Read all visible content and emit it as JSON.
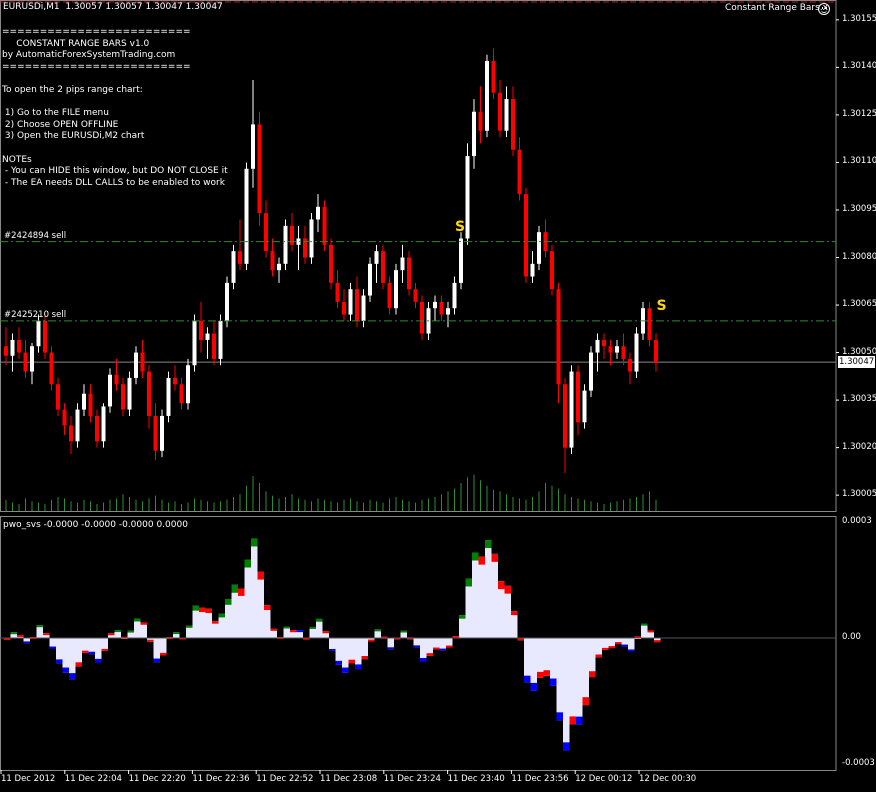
{
  "window": {
    "symbol_title": "EURUSDi,M1  1.30057 1.30057 1.30047 1.30047",
    "ea_title": "Constant Range Bars.x",
    "ea_status_icon": "smiley-icon"
  },
  "info_panel": {
    "lines": [
      "=========================",
      "     CONSTANT RANGE BARS v1.0",
      "by AutomaticForexSystemTrading.com",
      "=========================",
      "",
      "To open the 2 pips range chart:",
      "",
      " 1) Go to the FILE menu",
      " 2) Choose OPEN OFFLINE",
      " 3) Open the EURUSDi,M2 chart",
      "",
      "NOTEs",
      " - You can HIDE this window, but DO NOT CLOSE it",
      " - The EA needs DLL CALLS to be enabled to work"
    ]
  },
  "orders": [
    {
      "label": "#2424894 sell",
      "price": 1.30085
    },
    {
      "label": "#2425210 sell",
      "price": 1.3006
    }
  ],
  "signals": [
    {
      "text": "S",
      "bar_index": 70,
      "price": 1.30089
    },
    {
      "text": "S",
      "bar_index": 101,
      "price": 1.30064
    }
  ],
  "indicator": {
    "title": "pwo_svs -0.0000 -0.0000 -0.0000 0.0000",
    "scale_labels": [
      "0.0003",
      "0.00",
      "-0.0003"
    ]
  },
  "price_axis": {
    "labels": [
      "1.30155",
      "1.30140",
      "1.30125",
      "1.30110",
      "1.30095",
      "1.30080",
      "1.30065",
      "1.30050",
      "1.30035",
      "1.30020",
      "1.30005"
    ],
    "current_price": "1.30047",
    "current_value": 1.30047
  },
  "time_axis": {
    "labels": [
      "11 Dec 2012",
      "11 Dec 22:04",
      "11 Dec 22:20",
      "11 Dec 22:36",
      "11 Dec 22:52",
      "11 Dec 23:08",
      "11 Dec 23:24",
      "11 Dec 23:40",
      "11 Dec 23:56",
      "12 Dec 00:12",
      "12 Dec 00:30"
    ]
  },
  "colors": {
    "background": "#000000",
    "bull": "#ffffff",
    "bear": "#ff0000",
    "order_line": "#2e8b2e",
    "volume": "#2e8b2e",
    "signal": "#ffd700",
    "ind_fill": "#e8e8ff",
    "ind_blue": "#0000ff",
    "ind_green": "#008000",
    "ind_red": "#ff0000",
    "top_line": "#aa2222"
  },
  "chart_data": {
    "type": "candlestick",
    "ylim": [
      1.3,
      1.3016
    ],
    "bars": [
      [
        1.30052,
        1.30058,
        1.30046,
        1.30049
      ],
      [
        1.30049,
        1.30056,
        1.30044,
        1.30054
      ],
      [
        1.30054,
        1.30058,
        1.30048,
        1.3005
      ],
      [
        1.3005,
        1.30054,
        1.30042,
        1.30044
      ],
      [
        1.30044,
        1.30053,
        1.3004,
        1.30052
      ],
      [
        1.30052,
        1.30062,
        1.3005,
        1.3006
      ],
      [
        1.3006,
        1.30062,
        1.30048,
        1.3005
      ],
      [
        1.3005,
        1.30052,
        1.30038,
        1.3004
      ],
      [
        1.3004,
        1.30042,
        1.3003,
        1.30032
      ],
      [
        1.30032,
        1.30034,
        1.30024,
        1.30027
      ],
      [
        1.30027,
        1.3003,
        1.30018,
        1.30022
      ],
      [
        1.30022,
        1.30034,
        1.3002,
        1.30032
      ],
      [
        1.30032,
        1.3004,
        1.3003,
        1.30037
      ],
      [
        1.30037,
        1.3004,
        1.30028,
        1.3003
      ],
      [
        1.3003,
        1.30032,
        1.3002,
        1.30022
      ],
      [
        1.30022,
        1.30034,
        1.3002,
        1.30033
      ],
      [
        1.30033,
        1.30045,
        1.30031,
        1.30043
      ],
      [
        1.30043,
        1.30048,
        1.30038,
        1.3004
      ],
      [
        1.3004,
        1.30042,
        1.3003,
        1.30032
      ],
      [
        1.30032,
        1.30044,
        1.3003,
        1.30042
      ],
      [
        1.30042,
        1.30052,
        1.3004,
        1.3005
      ],
      [
        1.3005,
        1.30054,
        1.30042,
        1.30044
      ],
      [
        1.30044,
        1.30046,
        1.30026,
        1.3003
      ],
      [
        1.3003,
        1.30034,
        1.30016,
        1.30019
      ],
      [
        1.30019,
        1.30032,
        1.30017,
        1.3003
      ],
      [
        1.3003,
        1.30044,
        1.30028,
        1.30042
      ],
      [
        1.30042,
        1.30046,
        1.30038,
        1.3004
      ],
      [
        1.3004,
        1.30042,
        1.30032,
        1.30034
      ],
      [
        1.30034,
        1.30048,
        1.30032,
        1.30046
      ],
      [
        1.30046,
        1.30062,
        1.30044,
        1.3006
      ],
      [
        1.3006,
        1.30066,
        1.3005,
        1.30054
      ],
      [
        1.30054,
        1.30058,
        1.30048,
        1.30056
      ],
      [
        1.30056,
        1.3006,
        1.30046,
        1.30048
      ],
      [
        1.30048,
        1.30062,
        1.30046,
        1.3006
      ],
      [
        1.3006,
        1.30074,
        1.30058,
        1.30072
      ],
      [
        1.30072,
        1.30084,
        1.3007,
        1.30082
      ],
      [
        1.30082,
        1.30092,
        1.30076,
        1.30078
      ],
      [
        1.30078,
        1.3011,
        1.30076,
        1.30108
      ],
      [
        1.30108,
        1.30136,
        1.30102,
        1.30122
      ],
      [
        1.30122,
        1.30126,
        1.3009,
        1.30094
      ],
      [
        1.30094,
        1.30098,
        1.3008,
        1.30082
      ],
      [
        1.30082,
        1.30086,
        1.30074,
        1.30076
      ],
      [
        1.30076,
        1.3008,
        1.30072,
        1.30078
      ],
      [
        1.30078,
        1.30092,
        1.30076,
        1.3009
      ],
      [
        1.3009,
        1.30094,
        1.30082,
        1.30084
      ],
      [
        1.30084,
        1.3009,
        1.30076,
        1.30086
      ],
      [
        1.30086,
        1.3009,
        1.30078,
        1.3008
      ],
      [
        1.3008,
        1.30094,
        1.30078,
        1.30092
      ],
      [
        1.30092,
        1.301,
        1.30088,
        1.30096
      ],
      [
        1.30096,
        1.30098,
        1.30082,
        1.30084
      ],
      [
        1.30084,
        1.30086,
        1.3007,
        1.30072
      ],
      [
        1.30072,
        1.30076,
        1.30064,
        1.30066
      ],
      [
        1.30066,
        1.3007,
        1.3006,
        1.30062
      ],
      [
        1.30062,
        1.30072,
        1.3006,
        1.3007
      ],
      [
        1.3007,
        1.30074,
        1.30058,
        1.3006
      ],
      [
        1.3006,
        1.3007,
        1.30058,
        1.30068
      ],
      [
        1.30068,
        1.3008,
        1.30066,
        1.30078
      ],
      [
        1.30078,
        1.30084,
        1.30072,
        1.30082
      ],
      [
        1.30082,
        1.30084,
        1.3007,
        1.30072
      ],
      [
        1.30072,
        1.30074,
        1.30062,
        1.30064
      ],
      [
        1.30064,
        1.30078,
        1.30062,
        1.30076
      ],
      [
        1.30076,
        1.30084,
        1.30072,
        1.3008
      ],
      [
        1.3008,
        1.30082,
        1.30068,
        1.3007
      ],
      [
        1.3007,
        1.30072,
        1.30064,
        1.30066
      ],
      [
        1.30066,
        1.30068,
        1.30054,
        1.30056
      ],
      [
        1.30056,
        1.30066,
        1.30054,
        1.30064
      ],
      [
        1.30064,
        1.30068,
        1.3006,
        1.30066
      ],
      [
        1.30066,
        1.30068,
        1.3006,
        1.30062
      ],
      [
        1.30062,
        1.30066,
        1.30058,
        1.30064
      ],
      [
        1.30064,
        1.30074,
        1.30062,
        1.30072
      ],
      [
        1.30072,
        1.30088,
        1.3007,
        1.30086
      ],
      [
        1.30086,
        1.30116,
        1.30084,
        1.30112
      ],
      [
        1.30112,
        1.3013,
        1.30108,
        1.30126
      ],
      [
        1.30126,
        1.30134,
        1.30116,
        1.3012
      ],
      [
        1.3012,
        1.30144,
        1.30118,
        1.30142
      ],
      [
        1.30142,
        1.30146,
        1.3013,
        1.30132
      ],
      [
        1.30132,
        1.30136,
        1.30118,
        1.3012
      ],
      [
        1.3012,
        1.30134,
        1.30118,
        1.3013
      ],
      [
        1.3013,
        1.30134,
        1.30112,
        1.30114
      ],
      [
        1.30114,
        1.30118,
        1.30098,
        1.301
      ],
      [
        1.301,
        1.30102,
        1.30072,
        1.30074
      ],
      [
        1.30074,
        1.30082,
        1.30072,
        1.30078
      ],
      [
        1.30078,
        1.3009,
        1.30076,
        1.30088
      ],
      [
        1.30088,
        1.30092,
        1.3008,
        1.30082
      ],
      [
        1.30082,
        1.30084,
        1.30068,
        1.3007
      ],
      [
        1.3007,
        1.30072,
        1.30034,
        1.3004
      ],
      [
        1.3004,
        1.30042,
        1.30012,
        1.3002
      ],
      [
        1.3002,
        1.30046,
        1.30018,
        1.30044
      ],
      [
        1.30044,
        1.30046,
        1.30024,
        1.30028
      ],
      [
        1.30028,
        1.3004,
        1.30026,
        1.30038
      ],
      [
        1.30038,
        1.30052,
        1.30036,
        1.3005
      ],
      [
        1.3005,
        1.30056,
        1.30044,
        1.30054
      ],
      [
        1.30054,
        1.30056,
        1.30048,
        1.30052
      ],
      [
        1.30052,
        1.30054,
        1.30046,
        1.3005
      ],
      [
        1.3005,
        1.30054,
        1.30048,
        1.30052
      ],
      [
        1.30052,
        1.30056,
        1.30046,
        1.30048
      ],
      [
        1.30048,
        1.3005,
        1.3004,
        1.30044
      ],
      [
        1.30044,
        1.30058,
        1.30042,
        1.30056
      ],
      [
        1.30056,
        1.30066,
        1.30054,
        1.30064
      ],
      [
        1.30064,
        1.30066,
        1.30052,
        1.30054
      ],
      [
        1.30054,
        1.30056,
        1.30044,
        1.30047
      ]
    ],
    "volume": [
      8,
      6,
      5,
      9,
      7,
      6,
      5,
      8,
      10,
      9,
      7,
      6,
      8,
      7,
      5,
      6,
      8,
      9,
      12,
      10,
      8,
      7,
      9,
      11,
      8,
      6,
      7,
      5,
      6,
      9,
      8,
      7,
      6,
      7,
      8,
      10,
      12,
      18,
      25,
      20,
      14,
      11,
      9,
      10,
      12,
      9,
      8,
      7,
      9,
      8,
      7,
      6,
      8,
      9,
      7,
      6,
      8,
      7,
      6,
      9,
      10,
      8,
      7,
      6,
      8,
      9,
      10,
      12,
      14,
      16,
      20,
      24,
      26,
      22,
      18,
      15,
      14,
      12,
      10,
      9,
      8,
      10,
      14,
      20,
      18,
      16,
      12,
      10,
      9,
      8,
      7,
      6,
      5,
      6,
      7,
      8,
      9,
      10,
      12,
      14,
      8
    ]
  }
}
